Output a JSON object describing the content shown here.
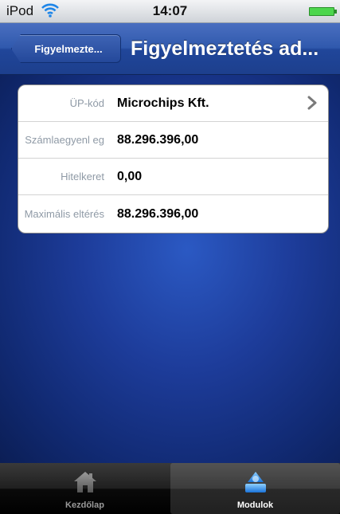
{
  "status_bar": {
    "carrier": "iPod",
    "time": "14:07"
  },
  "nav_bar": {
    "back_label": "Figyelmezte...",
    "title": "Figyelmeztetés ad..."
  },
  "details": [
    {
      "label": "ÜP-kód",
      "value": "Microchips Kft.",
      "has_disclosure": true
    },
    {
      "label": "Számlaegyenl eg",
      "value": "88.296.396,00",
      "has_disclosure": false
    },
    {
      "label": "Hitelkeret",
      "value": "0,00",
      "has_disclosure": false
    },
    {
      "label": "Maximális eltérés",
      "value": "88.296.396,00",
      "has_disclosure": false
    }
  ],
  "tab_bar": {
    "tabs": [
      {
        "label": "Kezdőlap",
        "icon": "home-icon",
        "selected": false
      },
      {
        "label": "Modulok",
        "icon": "modules-icon",
        "selected": true
      }
    ]
  },
  "colors": {
    "nav_blue": "#2a52a8",
    "background_blue": "#1d3c9a",
    "label_gray": "#8f9aa6",
    "battery_green": "#4dd64d"
  }
}
